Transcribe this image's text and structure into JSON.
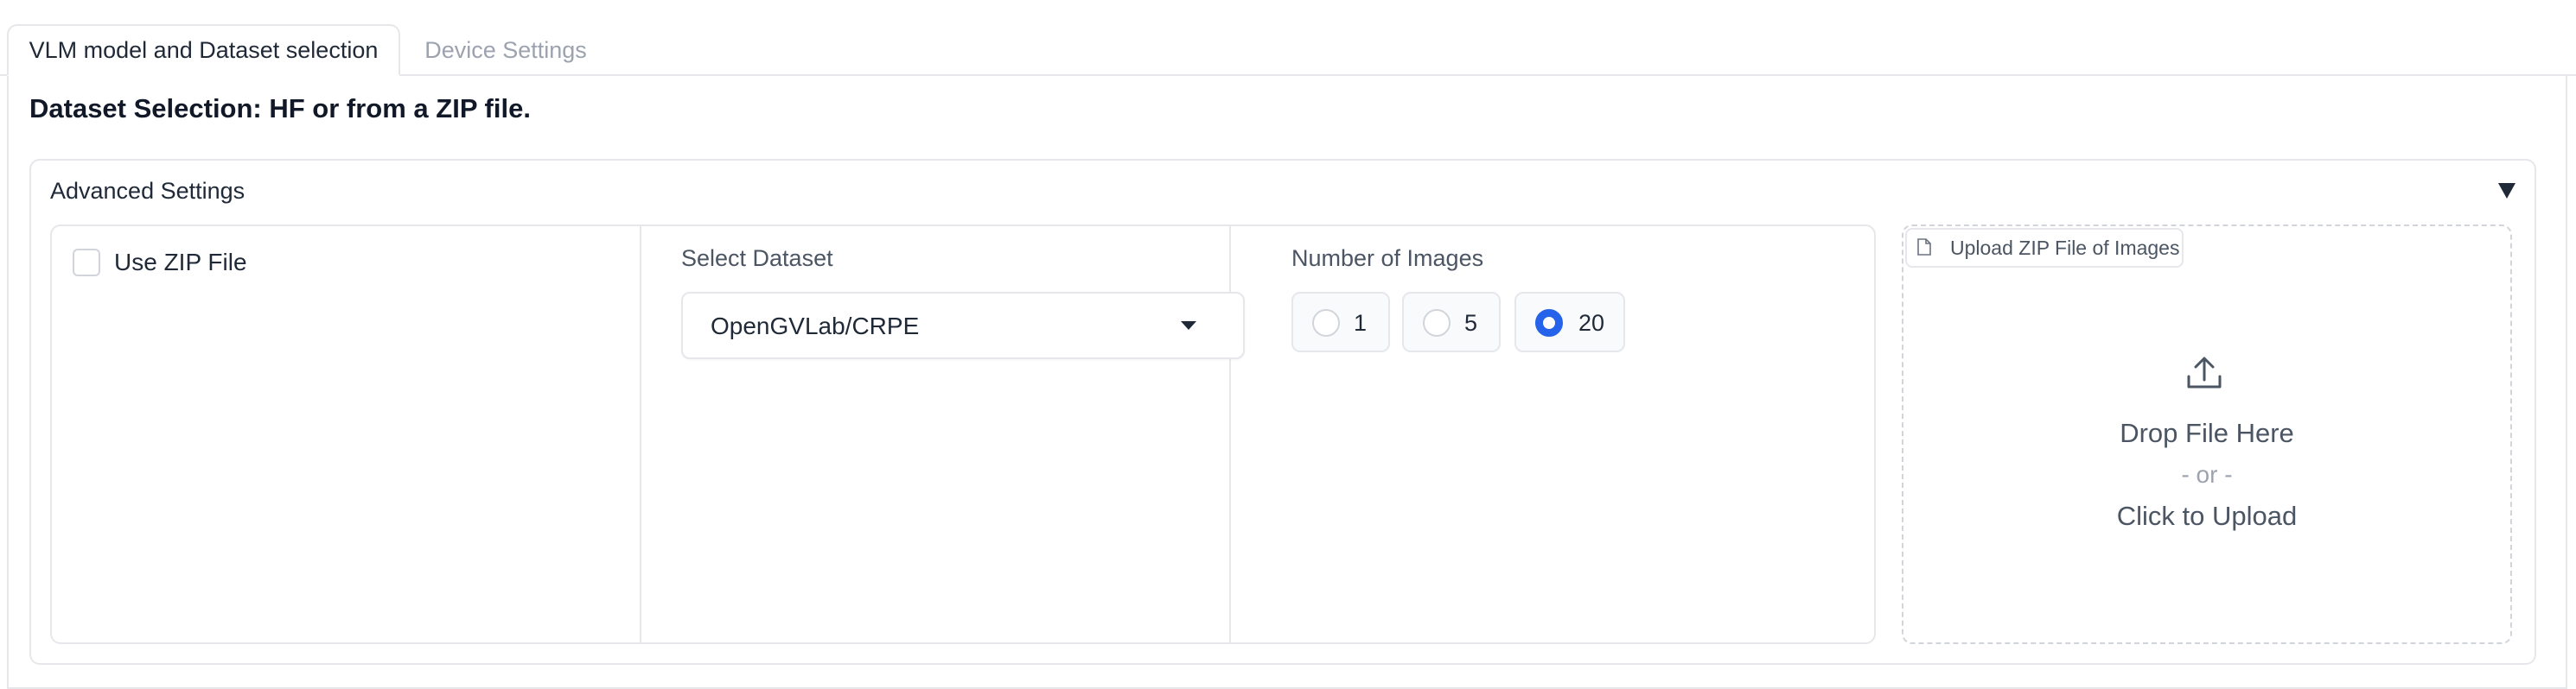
{
  "tabs": [
    {
      "label": "VLM model and Dataset selection",
      "active": true
    },
    {
      "label": "Device Settings",
      "active": false
    }
  ],
  "section_title": "Dataset Selection: HF or from a ZIP file.",
  "accordion": {
    "label": "Advanced Settings",
    "expanded": true,
    "toggle_icon": "triangle-down-icon"
  },
  "use_zip": {
    "label": "Use ZIP File",
    "checked": false
  },
  "select_dataset": {
    "label": "Select Dataset",
    "value": "OpenGVLab/CRPE"
  },
  "num_images": {
    "label": "Number of Images",
    "options": [
      "1",
      "5",
      "20"
    ],
    "selected": "20"
  },
  "upload": {
    "label": "Upload ZIP File of Images",
    "drop_text": "Drop File Here",
    "or_text": "- or -",
    "click_text": "Click to Upload",
    "icon": "upload-icon"
  },
  "colors": {
    "accent": "#2563eb",
    "border": "#e5e7eb",
    "muted_text": "#9ca3af"
  }
}
